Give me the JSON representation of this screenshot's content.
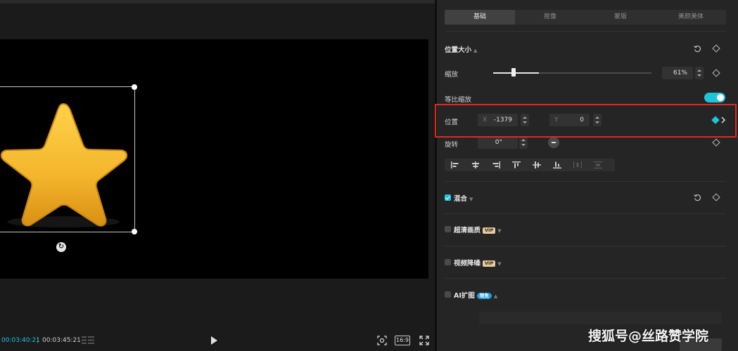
{
  "preview": {
    "time_current": "00:03:40:21",
    "time_separator": "|",
    "time_total": "00:03:45:21",
    "aspect_ratio": "16:9",
    "icons": [
      "list-icon",
      "play-icon",
      "fit-screen-icon",
      "fullscreen-icon",
      "rotate-icon",
      "star-image"
    ]
  },
  "tabs": [
    {
      "label": "基础",
      "active": true
    },
    {
      "label": "抠像",
      "active": false
    },
    {
      "label": "蒙版",
      "active": false
    },
    {
      "label": "美颜美体",
      "active": false
    }
  ],
  "position_size": {
    "title": "位置大小",
    "scale_label": "缩放",
    "scale_value": "61%",
    "scale_fraction": 0.61,
    "uniform_scale_label": "等比缩放",
    "uniform_scale_on": true,
    "position_label": "位置",
    "x_prefix": "X",
    "x_value": "-1379",
    "y_prefix": "Y",
    "y_value": "0",
    "rotate_label": "旋转",
    "rotate_value": "0°"
  },
  "blend": {
    "title": "混合",
    "checked": true
  },
  "hd_quality": {
    "title": "超清画质",
    "badge": "VIP",
    "checked": false
  },
  "denoise": {
    "title": "视频降噪",
    "badge": "VIP",
    "checked": false
  },
  "ai_expand": {
    "title": "AI扩图",
    "badge": "限免",
    "checked": false
  },
  "colors": {
    "accent": "#1ec4d8",
    "highlight": "#e0271f",
    "star": "#f3b52b"
  },
  "watermark": "搜狐号@丝路赞学院"
}
